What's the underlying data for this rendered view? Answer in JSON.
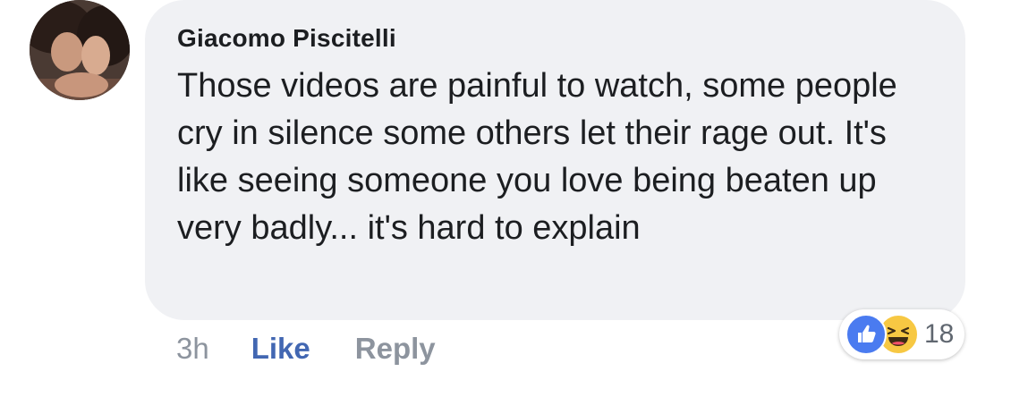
{
  "comment": {
    "author": "Giacomo Piscitelli",
    "text": "Those videos are painful to watch, some people cry in silence some others let their rage out. It's like seeing someone you love being beaten up very badly... it's hard to explain",
    "time": "3h",
    "like_label": "Like",
    "reply_label": "Reply",
    "reaction_count": "18",
    "reactions": [
      "like-icon",
      "haha-icon"
    ]
  },
  "colors": {
    "bubble": "#f0f1f4",
    "link_blue": "#4267b2",
    "meta_gray": "#8d949e",
    "like_blue": "#4a7bf0",
    "haha_yellow": "#f7c843"
  }
}
